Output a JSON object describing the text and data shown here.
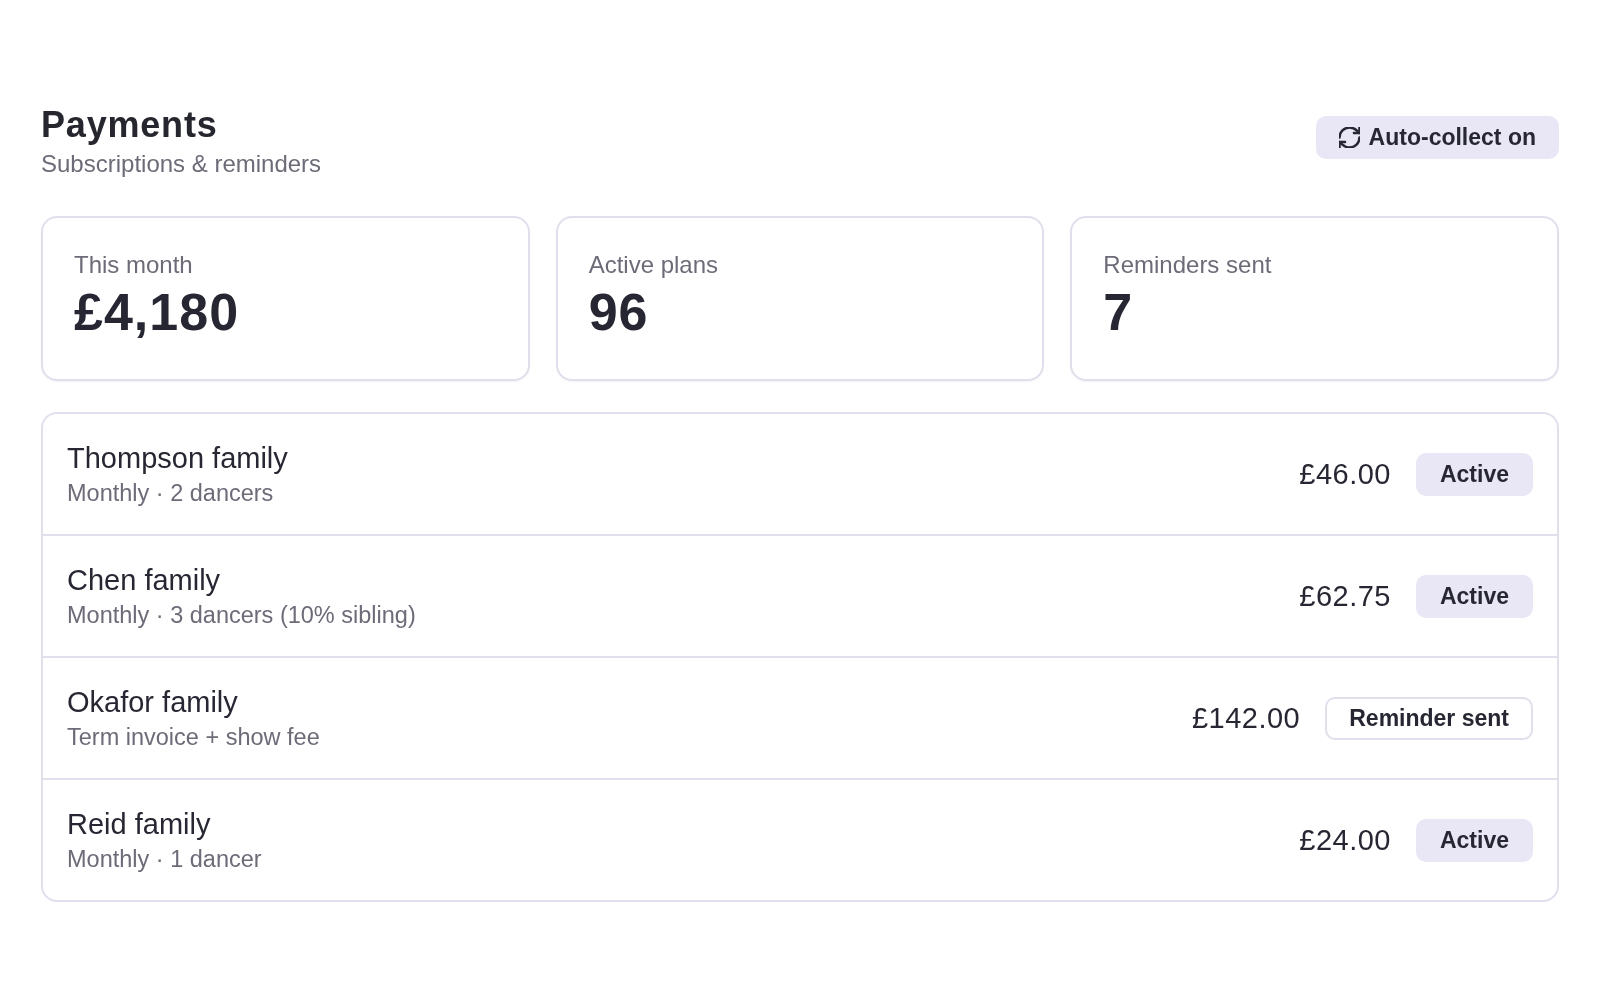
{
  "header": {
    "title": "Payments",
    "subtitle": "Subscriptions & reminders",
    "auto_collect": {
      "label": "Auto-collect on",
      "on": true
    }
  },
  "stats": [
    {
      "label": "This month",
      "value": "£4,180"
    },
    {
      "label": "Active plans",
      "value": "96"
    },
    {
      "label": "Reminders sent",
      "value": "7"
    }
  ],
  "payments": [
    {
      "name": "Thompson family",
      "detail": "Monthly · 2 dancers",
      "amount": "£46.00",
      "status": {
        "label": "Active",
        "kind": "active"
      }
    },
    {
      "name": "Chen family",
      "detail": "Monthly · 3 dancers (10% sibling)",
      "amount": "£62.75",
      "status": {
        "label": "Active",
        "kind": "active"
      }
    },
    {
      "name": "Okafor family",
      "detail": "Term invoice + show fee",
      "amount": "£142.00",
      "status": {
        "label": "Reminder sent",
        "kind": "reminder"
      }
    },
    {
      "name": "Reid family",
      "detail": "Monthly · 1 dancer",
      "amount": "£24.00",
      "status": {
        "label": "Active",
        "kind": "active"
      }
    }
  ]
}
